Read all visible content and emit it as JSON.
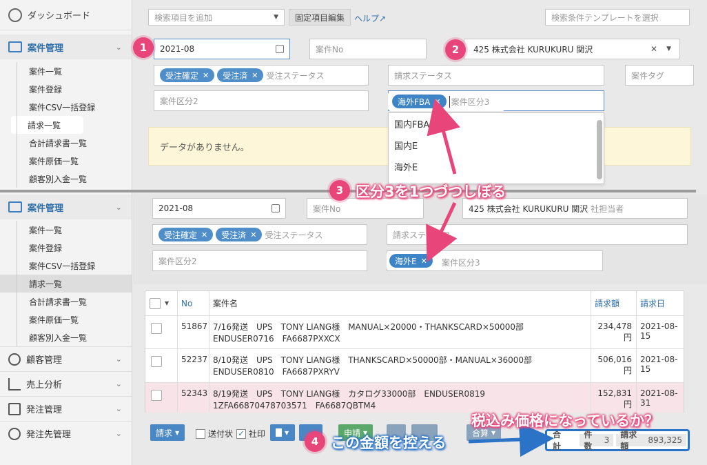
{
  "sidebar": {
    "dashboard": "ダッシュボード",
    "group_top": "案件管理",
    "items_top": [
      "案件一覧",
      "案件登録",
      "案件CSV一括登録",
      "請求一覧",
      "合計請求書一覧",
      "案件原価一覧",
      "顧客別入金一覧"
    ],
    "group_bottom": "案件管理",
    "items_bottom": [
      "案件一覧",
      "案件登録",
      "案件CSV一括登録",
      "請求一覧",
      "合計請求書一覧",
      "案件原価一覧",
      "顧客別入金一覧"
    ],
    "others": [
      "顧客管理",
      "売上分析",
      "発注管理",
      "発注先管理"
    ]
  },
  "topbar": {
    "add_search_placeholder": "検索項目を追加",
    "fixed_edit": "固定項目編集",
    "help": "ヘルプ",
    "template_placeholder": "検索条件テンプレートを選択"
  },
  "filters_top": {
    "date": "2021-08",
    "anken_no": "案件No",
    "customer": "425 株式会社 KURUKURU 関沢",
    "tags_status": [
      "受注確定",
      "受注済"
    ],
    "status_label": "受注ステータス",
    "billing_status": "請求ステータス",
    "anken_tag": "案件タグ",
    "kubun2": "案件区分2",
    "kubun3_tag": "海外FBA",
    "kubun3": "案件区分3",
    "dropdown_options": [
      "国内FBA",
      "国内E",
      "海外E"
    ],
    "nodata": "データがありません。"
  },
  "filters_bottom": {
    "date": "2021-08",
    "anken_no": "案件No",
    "customer": "425 株式会社 KURUKURU 関沢",
    "person": "社担当者",
    "tags_status": [
      "受注確定",
      "受注済"
    ],
    "status_label": "受注ステータス",
    "billing_status": "請求ステータス",
    "kubun2": "案件区分2",
    "kubun3_tag": "海外E",
    "kubun3": "案件区分3"
  },
  "table": {
    "headers": {
      "no": "No",
      "name": "案件名",
      "amount": "請求額",
      "date": "請求日"
    },
    "rows": [
      {
        "no": "51867",
        "name": "7/16発送　UPS　TONY LIANG様　MANUAL×20000・THANKSCARD×50000部　ENDUSER0716　FA6687PXXCX",
        "amount": "234,478円",
        "date": "2021-08-15"
      },
      {
        "no": "52237",
        "name": "8/10発送　UPS　TONY LIANG様　THANKSCARD×50000部・MANUAL×36000部　ENDUSER0810　FA6687PXRYV",
        "amount": "506,016円",
        "date": "2021-08-15"
      },
      {
        "no": "52343",
        "name": "8/19発送　UPS　TONY LIANG様　カタログ33000部　ENDUSER0819　1ZFA66870478703571　FA6687QBTM4",
        "amount": "152,831円",
        "date": "2021-08-31"
      }
    ]
  },
  "toolbar": {
    "seikyu": "請求",
    "soufu": "送付状",
    "shain": "社印",
    "shinsei": "申請",
    "gassan": "合算"
  },
  "summary": {
    "total": "合計",
    "count_label": "件数",
    "count": "3",
    "amount_label": "請求額",
    "amount": "893,325"
  },
  "callouts": {
    "b1": "1",
    "b2": "2",
    "b3": "3",
    "b4": "4",
    "step3": "区分3を1つづつしぼる",
    "step4": "この金額を控える",
    "tax_question": "税込み価格になっているか？"
  },
  "colors": {
    "accent": "#e8457a",
    "blue": "#2a73c6",
    "link": "#2d6ea8"
  }
}
